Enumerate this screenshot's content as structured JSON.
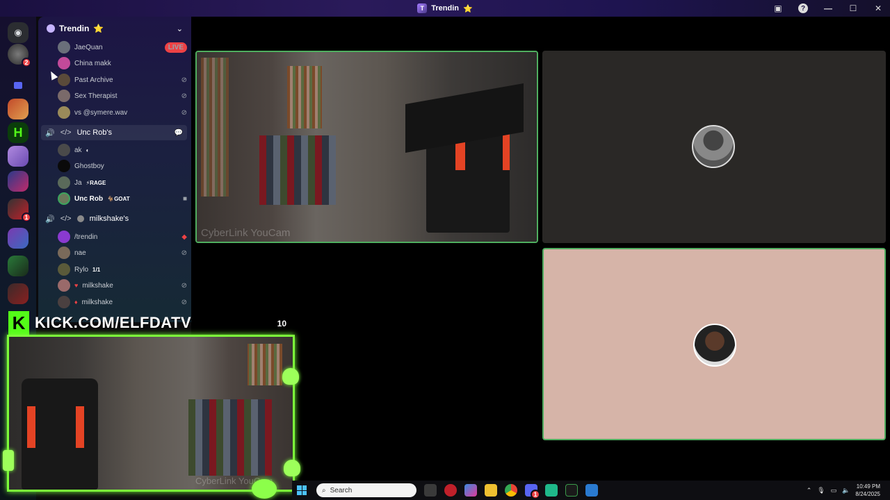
{
  "window": {
    "title": "Trendin",
    "title_emoji": "⭐"
  },
  "rail": {
    "dm_badge": "2",
    "server_badge": "1"
  },
  "server": {
    "name": "Trendin",
    "emoji": "⭐"
  },
  "text_users": [
    {
      "name": "JaeQuan",
      "right": "LIVE"
    },
    {
      "name": "China makk",
      "right": ""
    },
    {
      "name": "Past Archive",
      "right": "muted"
    },
    {
      "name": "Sex Therapist",
      "right": "muted"
    },
    {
      "name": "vs @symere.wav",
      "right": "muted"
    }
  ],
  "voice_channels": [
    {
      "name": "Unc Rob's",
      "members": [
        {
          "name": "ak",
          "tag": "◐"
        },
        {
          "name": "Ghostboy",
          "tag": ""
        },
        {
          "name": "Ja",
          "tag": "⚡RAGE"
        },
        {
          "name": "Unc Rob",
          "tag": "🐐GOAT"
        }
      ]
    },
    {
      "name": "milkshake's",
      "members": [
        {
          "name": "/trendin",
          "tag": ""
        },
        {
          "name": "nae",
          "tag": ""
        },
        {
          "name": "Rylo",
          "tag": "1/1"
        },
        {
          "name": "milkshake",
          "tag": ""
        },
        {
          "name": "milkshake",
          "tag": ""
        }
      ]
    }
  ],
  "video": {
    "cam_label": "CyberLink YouCam"
  },
  "overlay": {
    "kick_letter": "K",
    "kick_url": "KICK.COM/ELFDATV",
    "count": "10",
    "cam_label": "CyberLink YouCam"
  },
  "taskbar": {
    "search_placeholder": "Search",
    "time": "10:49 PM",
    "date": "8/24/2025",
    "discord_badge": "1"
  },
  "colors": {
    "green_border": "#4fae5f",
    "kick_green": "#53fc18",
    "live_red": "#ed4245"
  }
}
